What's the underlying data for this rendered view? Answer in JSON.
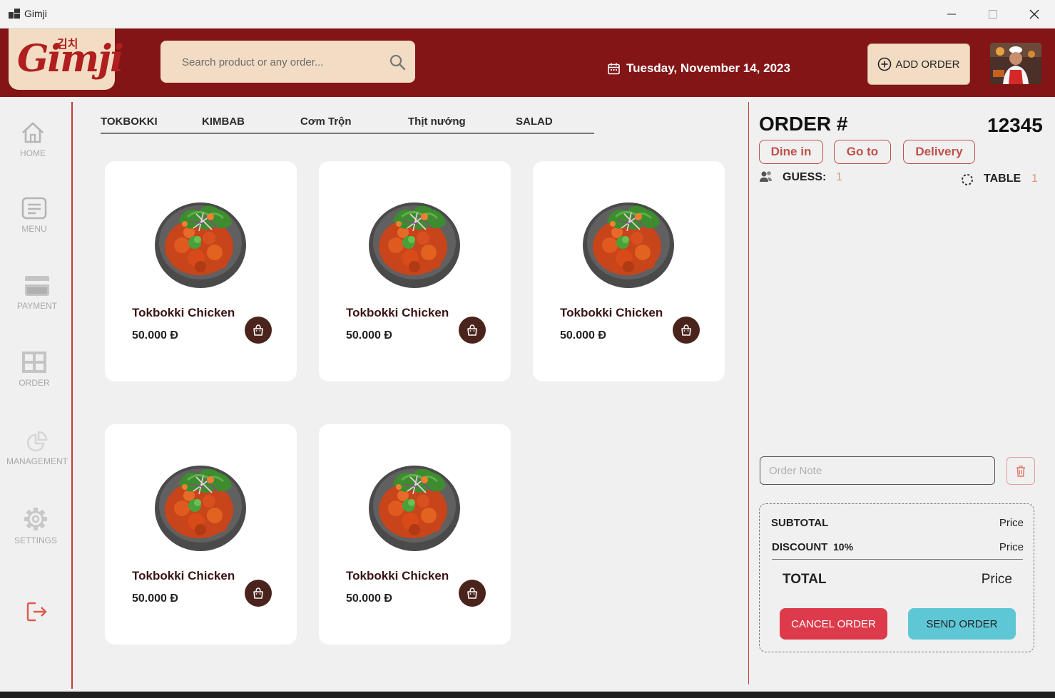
{
  "window": {
    "title": "Gimji"
  },
  "header": {
    "logo_text": "Gimji",
    "logo_korean": "김치",
    "search_placeholder": "Search product or any order...",
    "date": "Tuesday, November 14, 2023",
    "add_order_label": "ADD ORDER"
  },
  "sidebar": {
    "items": [
      {
        "label": "HOME",
        "icon": "home-icon"
      },
      {
        "label": "MENU",
        "icon": "menu-icon"
      },
      {
        "label": "PAYMENT",
        "icon": "credit-card-icon"
      },
      {
        "label": "ORDER",
        "icon": "grid-icon"
      },
      {
        "label": "MANAGEMENT",
        "icon": "pie-chart-icon"
      },
      {
        "label": "SETTINGS",
        "icon": "gear-icon"
      }
    ],
    "logout_icon": "logout-icon"
  },
  "tabs": [
    "TOKBOKKI",
    "KIMBAB",
    "Cơm Trộn",
    "Thịt nướng",
    "SALAD"
  ],
  "products": [
    {
      "name": "Tokbokki Chicken",
      "price": "50.000 Đ"
    },
    {
      "name": "Tokbokki Chicken",
      "price": "50.000 Đ"
    },
    {
      "name": "Tokbokki Chicken",
      "price": "50.000 Đ"
    },
    {
      "name": "Tokbokki Chicken",
      "price": "50.000 Đ"
    },
    {
      "name": "Tokbokki Chicken",
      "price": "50.000 Đ"
    }
  ],
  "order": {
    "title": "ORDER #",
    "number": "12345",
    "types": [
      "Dine in",
      "Go to",
      "Delivery"
    ],
    "guest_label": "GUESS:",
    "guest_value": "1",
    "table_label": "TABLE",
    "table_value": "1",
    "note_placeholder": "Order Note",
    "subtotal_label": "SUBTOTAL",
    "subtotal_value": "Price",
    "discount_label": "DISCOUNT",
    "discount_percent": "10%",
    "discount_value": "Price",
    "total_label": "TOTAL",
    "total_value": "Price",
    "cancel_label": "CANCEL ORDER",
    "send_label": "SEND ORDER"
  },
  "colors": {
    "brand": "#831516",
    "cream": "#f2dcc3",
    "accent": "#c0504a",
    "cancel": "#dd3b4b",
    "send": "#5ec7d6"
  }
}
